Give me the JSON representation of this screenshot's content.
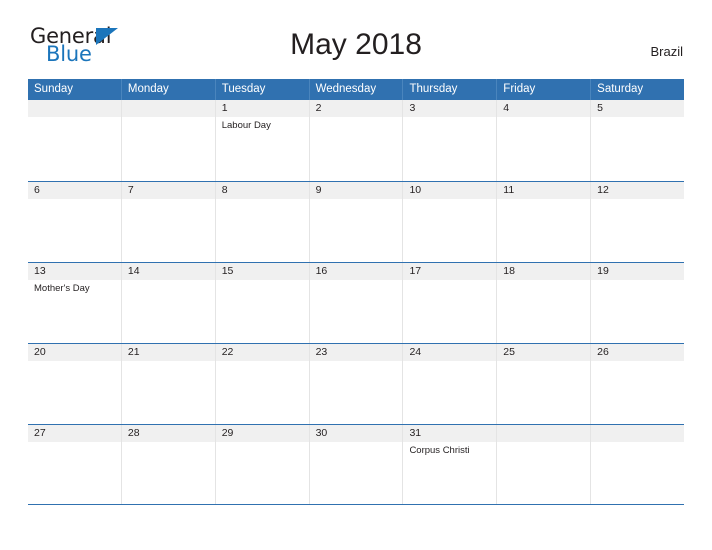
{
  "brand": {
    "name_top": "General",
    "name_bottom": "Blue"
  },
  "header": {
    "title": "May 2018",
    "region": "Brazil"
  },
  "colors": {
    "header_blue": "#3071b0",
    "brand_blue": "#1b75bb",
    "band_gray": "#f0f0f0",
    "text": "#231f20"
  },
  "weekdays": [
    "Sunday",
    "Monday",
    "Tuesday",
    "Wednesday",
    "Thursday",
    "Friday",
    "Saturday"
  ],
  "weeks": [
    [
      {
        "date": "",
        "events": []
      },
      {
        "date": "",
        "events": []
      },
      {
        "date": "1",
        "events": [
          "Labour Day"
        ]
      },
      {
        "date": "2",
        "events": []
      },
      {
        "date": "3",
        "events": []
      },
      {
        "date": "4",
        "events": []
      },
      {
        "date": "5",
        "events": []
      }
    ],
    [
      {
        "date": "6",
        "events": []
      },
      {
        "date": "7",
        "events": []
      },
      {
        "date": "8",
        "events": []
      },
      {
        "date": "9",
        "events": []
      },
      {
        "date": "10",
        "events": []
      },
      {
        "date": "11",
        "events": []
      },
      {
        "date": "12",
        "events": []
      }
    ],
    [
      {
        "date": "13",
        "events": [
          "Mother's Day"
        ]
      },
      {
        "date": "14",
        "events": []
      },
      {
        "date": "15",
        "events": []
      },
      {
        "date": "16",
        "events": []
      },
      {
        "date": "17",
        "events": []
      },
      {
        "date": "18",
        "events": []
      },
      {
        "date": "19",
        "events": []
      }
    ],
    [
      {
        "date": "20",
        "events": []
      },
      {
        "date": "21",
        "events": []
      },
      {
        "date": "22",
        "events": []
      },
      {
        "date": "23",
        "events": []
      },
      {
        "date": "24",
        "events": []
      },
      {
        "date": "25",
        "events": []
      },
      {
        "date": "26",
        "events": []
      }
    ],
    [
      {
        "date": "27",
        "events": []
      },
      {
        "date": "28",
        "events": []
      },
      {
        "date": "29",
        "events": []
      },
      {
        "date": "30",
        "events": []
      },
      {
        "date": "31",
        "events": [
          "Corpus Christi"
        ]
      },
      {
        "date": "",
        "events": []
      },
      {
        "date": "",
        "events": []
      }
    ]
  ]
}
